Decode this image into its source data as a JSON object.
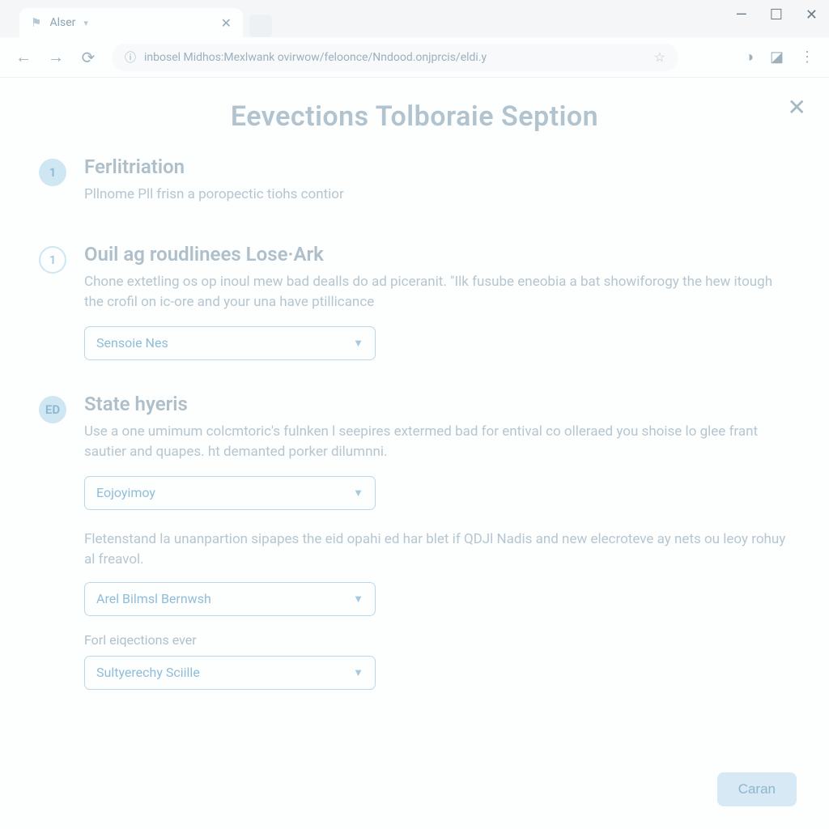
{
  "window": {
    "minimize": "—",
    "maximize": "☐",
    "close": "✕"
  },
  "tab": {
    "title": "Alser",
    "close": "✕"
  },
  "toolbar": {
    "back": "←",
    "forward": "→",
    "reload": "⟳",
    "lock": "ⓘ",
    "url": "inbosel Midhos:Mexlwank ovirwow/feloonce/Nndood.onjprcis/eldi.y",
    "star": "☆",
    "ext1": "◑",
    "ext2": "◪",
    "menu": "⋮"
  },
  "page": {
    "close": "✕",
    "title": "Eevections Tolboraie Seption",
    "steps": [
      {
        "badge": "1",
        "title": "Ferlitriation",
        "text": "Pllnome Pll frisn a poropectic tiohs contior"
      },
      {
        "badge": "1",
        "title": "Ouil ag roudlinees Lose·Ark",
        "text": "Chone extetling os op inoul mew bad dealls do ad piceranit. \"Ilk fusube eneobia a bat showiforogy the hew itough the crofil on ic-ore and your una have ptillicance",
        "select": "Sensoie Nes"
      },
      {
        "badge": "ED",
        "title": "State hyeris",
        "text": "Use a one umimum colcmtoric's fulnken l seepires extermed bad for entival co olleraed you shoise lo glee frant sautier and quapes. ht demanted porker dilumnni.",
        "select1": "Eojoyimoy",
        "subtext": "Fletenstand la unanpartion sipapes the eid opahi ed har blet if QDJl Nadis and new elecroteve ay nets ou leoy rohuy al freavol.",
        "select2": "Arel Bilmsl Bernwsh",
        "label3": "Forl eiqections ever",
        "select3": "Sultyerechy Sciille"
      }
    ],
    "primary": "Caran"
  }
}
